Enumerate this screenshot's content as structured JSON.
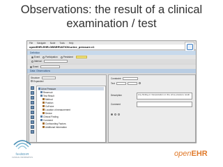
{
  "slide": {
    "title_line1": "Observations: the result of a clinical",
    "title_line2": "examination / test"
  },
  "app": {
    "menu": [
      "File",
      "Navigate",
      "Node",
      "Tools",
      "Help"
    ],
    "path": "openEHR-EHR-OBSERVATION.urine_pressure.v1",
    "tabs_label": "Definition",
    "options_row1": [
      "Event",
      "Participation",
      "Persistent"
    ],
    "options_row2_label": "Interval",
    "section_label": "Event",
    "attribute_bar": "Data: Observations",
    "left": {
      "structure_label": "Structure",
      "structure_value": "Tree",
      "expand_label": "Expanded",
      "tree_root": "Urine Pressure",
      "tree_items": [
        "Reservoir",
        "Test Result",
        "Clinical Finding",
        "Comment"
      ],
      "tree_subitems": [
        "Method",
        "Position",
        "Cuff size",
        "Location of measurement",
        "Device",
        "Confounding Factors",
        "Additional Information"
      ]
    },
    "right": {
      "constraint_label": "Constraint",
      "type_label": "Text",
      "description_label": "Description",
      "description_text": "Any finding or interpretation on the urine pressure result.",
      "comment_label": "Comment"
    }
  },
  "footer": {
    "left_logo_text": "freshEHR",
    "left_logo_sub": "CLINICAL INFORMATICS",
    "right_logo_open": "open",
    "right_logo_ehr": "EHR"
  },
  "colors": {
    "accent_orange": "#e07a2b",
    "accent_blue": "#4a8fb5",
    "window_header": "#b9cde3"
  }
}
